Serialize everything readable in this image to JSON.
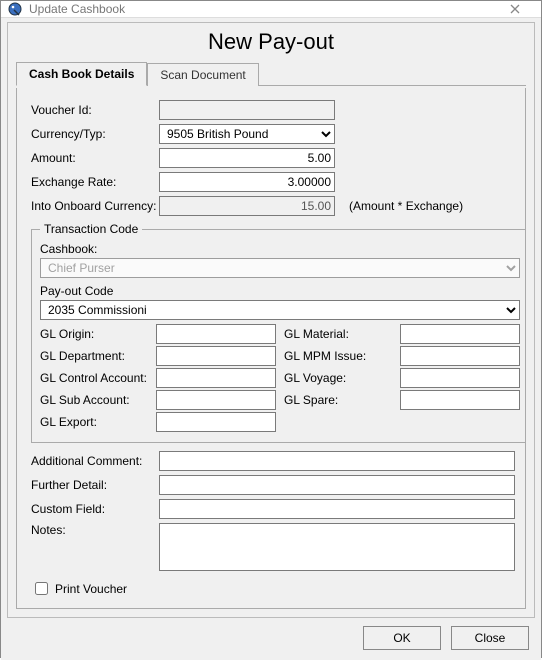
{
  "window": {
    "title": "Update Cashbook"
  },
  "header": {
    "title": "New Pay-out"
  },
  "tabs": {
    "details": "Cash Book Details",
    "scan": "Scan Document"
  },
  "labels": {
    "voucher_id": "Voucher Id:",
    "currency": "Currency/Typ:",
    "amount": "Amount:",
    "exchange": "Exchange Rate:",
    "into_onboard": "Into Onboard Currency:",
    "hint": "(Amount * Exchange)",
    "transaction_code": "Transaction Code",
    "cashbook": "Cashbook:",
    "payout_code": "Pay-out Code",
    "gl_origin": "GL Origin:",
    "gl_department": "GL Department:",
    "gl_control_account": "GL Control Account:",
    "gl_sub_account": "GL Sub Account:",
    "gl_export": "GL Export:",
    "gl_material": "GL Material:",
    "gl_mpm_issue": "GL MPM Issue:",
    "gl_voyage": "GL Voyage:",
    "gl_spare": "GL Spare:",
    "additional_comment": "Additional Comment:",
    "further_detail": "Further Detail:",
    "custom_field": "Custom Field:",
    "notes": "Notes:",
    "print_voucher": "Print Voucher"
  },
  "values": {
    "voucher_id": "",
    "currency": "9505 British Pound",
    "amount": "5.00",
    "exchange": "3.00000",
    "into_onboard": "15.00",
    "cashbook": "Chief Purser",
    "payout_code": "2035 Commissioni",
    "gl_origin": "",
    "gl_department": "",
    "gl_control_account": "",
    "gl_sub_account": "",
    "gl_export": "",
    "gl_material": "",
    "gl_mpm_issue": "",
    "gl_voyage": "",
    "gl_spare": "",
    "additional_comment": "",
    "further_detail": "",
    "custom_field": "",
    "notes": ""
  },
  "buttons": {
    "ok": "OK",
    "close": "Close"
  }
}
